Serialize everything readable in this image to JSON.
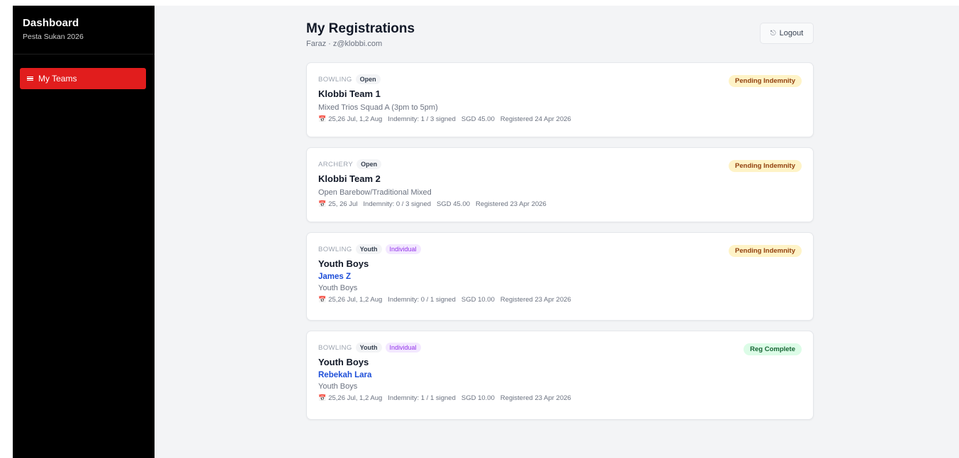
{
  "sidebar": {
    "title": "Dashboard",
    "subtitle": "Pesta Sukan 2026",
    "nav": [
      {
        "label": "My Teams",
        "icon": "menu-icon",
        "active": true
      }
    ]
  },
  "header": {
    "title": "My Registrations",
    "subtitle": "Faraz · z@klobbi.com",
    "logout_label": "Logout",
    "logout_icon": "⎋"
  },
  "registrations": [
    {
      "sport": "BOWLING",
      "tags": [
        "Open"
      ],
      "team": "Klobbi Team 1",
      "player": "",
      "division": "Mixed Trios Squad A (3pm to 5pm)",
      "dates": "25,26 Jul, 1,2 Aug",
      "indemnity": "Indemnity: 1 / 3 signed",
      "fee": "SGD 45.00",
      "registered": "Registered 24 Apr 2026",
      "status": "Pending Indemnity"
    },
    {
      "sport": "ARCHERY",
      "tags": [
        "Open"
      ],
      "team": "Klobbi Team 2",
      "player": "",
      "division": "Open Barebow/Traditional Mixed",
      "dates": "25, 26 Jul",
      "indemnity": "Indemnity: 0 / 3 signed",
      "fee": "SGD 45.00",
      "registered": "Registered 23 Apr 2026",
      "status": "Pending Indemnity"
    },
    {
      "sport": "BOWLING",
      "tags": [
        "Youth",
        "Individual"
      ],
      "team": "Youth Boys",
      "player": "James Z",
      "division": "Youth Boys",
      "dates": "25,26 Jul, 1,2 Aug",
      "indemnity": "Indemnity: 0 / 1 signed",
      "fee": "SGD 10.00",
      "registered": "Registered 23 Apr 2026",
      "status": "Pending Indemnity"
    },
    {
      "sport": "BOWLING",
      "tags": [
        "Youth",
        "Individual"
      ],
      "team": "Youth Boys",
      "player": "Rebekah Lara",
      "division": "Youth Boys",
      "dates": "25,26 Jul, 1,2 Aug",
      "indemnity": "Indemnity: 1 / 1 signed",
      "fee": "SGD 10.00",
      "registered": "Registered 23 Apr 2026",
      "status": "Reg Complete"
    }
  ],
  "colors": {
    "sidebar_bg": "#000000",
    "active_nav": "#e11d1d",
    "pending_bg": "#fef3c7",
    "complete_bg": "#dcfce7",
    "player_link": "#1d4ed8"
  },
  "icons": {
    "calendar": "📅"
  }
}
